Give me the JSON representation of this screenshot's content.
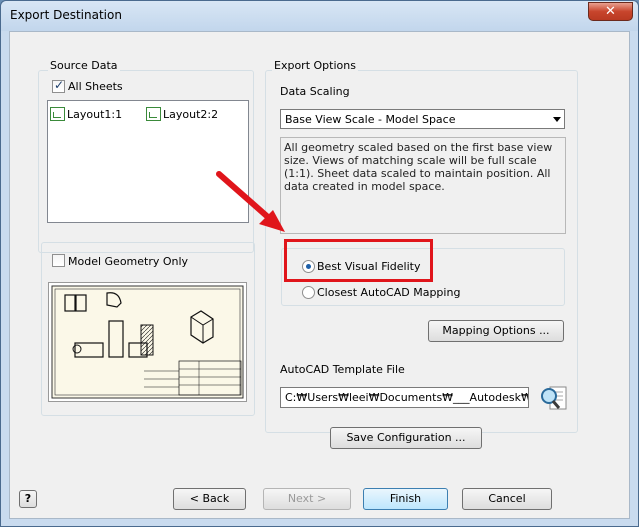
{
  "window": {
    "title": "Export Destination",
    "close_label": "✕"
  },
  "source_data": {
    "group_label": "Source Data",
    "all_sheets_label": "All Sheets",
    "all_sheets_checked": true,
    "layouts": [
      "Layout1:1",
      "Layout2:2"
    ]
  },
  "model_geometry": {
    "label": "Model Geometry Only",
    "checked": false
  },
  "export_options": {
    "group_label": "Export Options",
    "data_scaling_label": "Data Scaling",
    "scaling_value": "Base View Scale - Model Space",
    "description": "All geometry scaled based on the first base view size. Views of matching scale will be full scale (1:1). Sheet data scaled to maintain position. All data created in model space.",
    "radio_best": "Best Visual Fidelity",
    "radio_closest": "Closest AutoCAD Mapping",
    "selected_radio": "Best Visual Fidelity",
    "mapping_button": "Mapping Options ...",
    "template_label": "AutoCAD Template File",
    "template_path": "C:₩Users₩leei₩Documents₩___Autodesk₩Cas",
    "save_config_button": "Save Configuration ..."
  },
  "footer": {
    "help_label": "?",
    "back_label": "< Back",
    "next_label": "Next >",
    "finish_label": "Finish",
    "cancel_label": "Cancel"
  },
  "annotation": {
    "arrow_color": "#e0151b",
    "box_color": "#e0151b"
  }
}
